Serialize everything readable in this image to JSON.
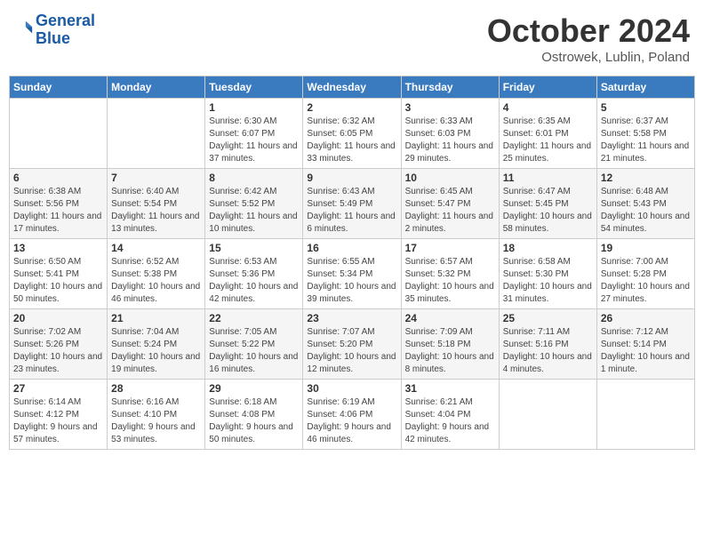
{
  "header": {
    "logo_line1": "General",
    "logo_line2": "Blue",
    "month": "October 2024",
    "location": "Ostrowek, Lublin, Poland"
  },
  "weekdays": [
    "Sunday",
    "Monday",
    "Tuesday",
    "Wednesday",
    "Thursday",
    "Friday",
    "Saturday"
  ],
  "weeks": [
    [
      {
        "day": "",
        "sunrise": "",
        "sunset": "",
        "daylight": ""
      },
      {
        "day": "",
        "sunrise": "",
        "sunset": "",
        "daylight": ""
      },
      {
        "day": "1",
        "sunrise": "Sunrise: 6:30 AM",
        "sunset": "Sunset: 6:07 PM",
        "daylight": "Daylight: 11 hours and 37 minutes."
      },
      {
        "day": "2",
        "sunrise": "Sunrise: 6:32 AM",
        "sunset": "Sunset: 6:05 PM",
        "daylight": "Daylight: 11 hours and 33 minutes."
      },
      {
        "day": "3",
        "sunrise": "Sunrise: 6:33 AM",
        "sunset": "Sunset: 6:03 PM",
        "daylight": "Daylight: 11 hours and 29 minutes."
      },
      {
        "day": "4",
        "sunrise": "Sunrise: 6:35 AM",
        "sunset": "Sunset: 6:01 PM",
        "daylight": "Daylight: 11 hours and 25 minutes."
      },
      {
        "day": "5",
        "sunrise": "Sunrise: 6:37 AM",
        "sunset": "Sunset: 5:58 PM",
        "daylight": "Daylight: 11 hours and 21 minutes."
      }
    ],
    [
      {
        "day": "6",
        "sunrise": "Sunrise: 6:38 AM",
        "sunset": "Sunset: 5:56 PM",
        "daylight": "Daylight: 11 hours and 17 minutes."
      },
      {
        "day": "7",
        "sunrise": "Sunrise: 6:40 AM",
        "sunset": "Sunset: 5:54 PM",
        "daylight": "Daylight: 11 hours and 13 minutes."
      },
      {
        "day": "8",
        "sunrise": "Sunrise: 6:42 AM",
        "sunset": "Sunset: 5:52 PM",
        "daylight": "Daylight: 11 hours and 10 minutes."
      },
      {
        "day": "9",
        "sunrise": "Sunrise: 6:43 AM",
        "sunset": "Sunset: 5:49 PM",
        "daylight": "Daylight: 11 hours and 6 minutes."
      },
      {
        "day": "10",
        "sunrise": "Sunrise: 6:45 AM",
        "sunset": "Sunset: 5:47 PM",
        "daylight": "Daylight: 11 hours and 2 minutes."
      },
      {
        "day": "11",
        "sunrise": "Sunrise: 6:47 AM",
        "sunset": "Sunset: 5:45 PM",
        "daylight": "Daylight: 10 hours and 58 minutes."
      },
      {
        "day": "12",
        "sunrise": "Sunrise: 6:48 AM",
        "sunset": "Sunset: 5:43 PM",
        "daylight": "Daylight: 10 hours and 54 minutes."
      }
    ],
    [
      {
        "day": "13",
        "sunrise": "Sunrise: 6:50 AM",
        "sunset": "Sunset: 5:41 PM",
        "daylight": "Daylight: 10 hours and 50 minutes."
      },
      {
        "day": "14",
        "sunrise": "Sunrise: 6:52 AM",
        "sunset": "Sunset: 5:38 PM",
        "daylight": "Daylight: 10 hours and 46 minutes."
      },
      {
        "day": "15",
        "sunrise": "Sunrise: 6:53 AM",
        "sunset": "Sunset: 5:36 PM",
        "daylight": "Daylight: 10 hours and 42 minutes."
      },
      {
        "day": "16",
        "sunrise": "Sunrise: 6:55 AM",
        "sunset": "Sunset: 5:34 PM",
        "daylight": "Daylight: 10 hours and 39 minutes."
      },
      {
        "day": "17",
        "sunrise": "Sunrise: 6:57 AM",
        "sunset": "Sunset: 5:32 PM",
        "daylight": "Daylight: 10 hours and 35 minutes."
      },
      {
        "day": "18",
        "sunrise": "Sunrise: 6:58 AM",
        "sunset": "Sunset: 5:30 PM",
        "daylight": "Daylight: 10 hours and 31 minutes."
      },
      {
        "day": "19",
        "sunrise": "Sunrise: 7:00 AM",
        "sunset": "Sunset: 5:28 PM",
        "daylight": "Daylight: 10 hours and 27 minutes."
      }
    ],
    [
      {
        "day": "20",
        "sunrise": "Sunrise: 7:02 AM",
        "sunset": "Sunset: 5:26 PM",
        "daylight": "Daylight: 10 hours and 23 minutes."
      },
      {
        "day": "21",
        "sunrise": "Sunrise: 7:04 AM",
        "sunset": "Sunset: 5:24 PM",
        "daylight": "Daylight: 10 hours and 19 minutes."
      },
      {
        "day": "22",
        "sunrise": "Sunrise: 7:05 AM",
        "sunset": "Sunset: 5:22 PM",
        "daylight": "Daylight: 10 hours and 16 minutes."
      },
      {
        "day": "23",
        "sunrise": "Sunrise: 7:07 AM",
        "sunset": "Sunset: 5:20 PM",
        "daylight": "Daylight: 10 hours and 12 minutes."
      },
      {
        "day": "24",
        "sunrise": "Sunrise: 7:09 AM",
        "sunset": "Sunset: 5:18 PM",
        "daylight": "Daylight: 10 hours and 8 minutes."
      },
      {
        "day": "25",
        "sunrise": "Sunrise: 7:11 AM",
        "sunset": "Sunset: 5:16 PM",
        "daylight": "Daylight: 10 hours and 4 minutes."
      },
      {
        "day": "26",
        "sunrise": "Sunrise: 7:12 AM",
        "sunset": "Sunset: 5:14 PM",
        "daylight": "Daylight: 10 hours and 1 minute."
      }
    ],
    [
      {
        "day": "27",
        "sunrise": "Sunrise: 6:14 AM",
        "sunset": "Sunset: 4:12 PM",
        "daylight": "Daylight: 9 hours and 57 minutes."
      },
      {
        "day": "28",
        "sunrise": "Sunrise: 6:16 AM",
        "sunset": "Sunset: 4:10 PM",
        "daylight": "Daylight: 9 hours and 53 minutes."
      },
      {
        "day": "29",
        "sunrise": "Sunrise: 6:18 AM",
        "sunset": "Sunset: 4:08 PM",
        "daylight": "Daylight: 9 hours and 50 minutes."
      },
      {
        "day": "30",
        "sunrise": "Sunrise: 6:19 AM",
        "sunset": "Sunset: 4:06 PM",
        "daylight": "Daylight: 9 hours and 46 minutes."
      },
      {
        "day": "31",
        "sunrise": "Sunrise: 6:21 AM",
        "sunset": "Sunset: 4:04 PM",
        "daylight": "Daylight: 9 hours and 42 minutes."
      },
      {
        "day": "",
        "sunrise": "",
        "sunset": "",
        "daylight": ""
      },
      {
        "day": "",
        "sunrise": "",
        "sunset": "",
        "daylight": ""
      }
    ]
  ]
}
